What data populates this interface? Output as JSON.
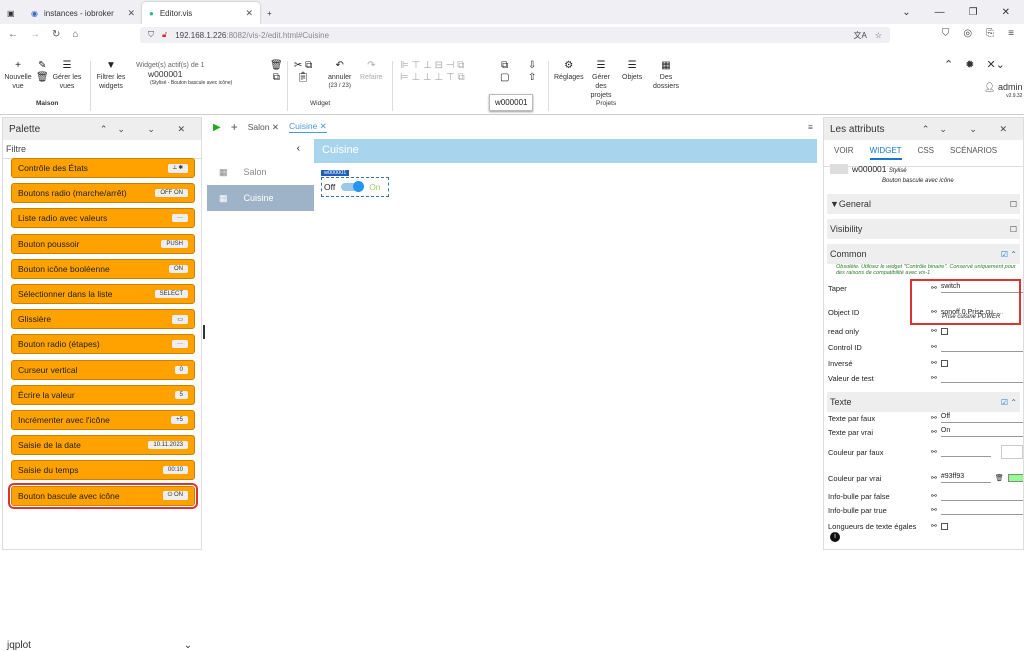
{
  "browser": {
    "tabs": [
      {
        "label": "instances - iobroker"
      },
      {
        "label": "Editor.vis"
      }
    ],
    "url_prefix": "192.168.1.226",
    "url_rest": ":8082/vis-2/edit.html#Cuisine"
  },
  "toolbar": {
    "nouvelle": "Nouvelle vue",
    "gerer_vues": "Gérer les vues",
    "maison": "Maison",
    "filtrer": "Filtrer les widgets",
    "widgets_actifs": "Widget(s) actif(s) de 1",
    "widget_id": "w000001",
    "widget_desc": "(Stylisé - Bouton bascule avec icône)",
    "annuler": "annuler",
    "annuler_count": "(23 / 23)",
    "refaire": "Refaire",
    "widget_section": "Widget",
    "reglages": "Réglages",
    "gerer_projets": "Gérer des projets",
    "objets": "Objets",
    "des_dossiers": "Des dossiers",
    "projets_section": "Projets",
    "user": "admin",
    "version": "v2.9.32",
    "tooltip": "w000001"
  },
  "palette": {
    "title": "Palette",
    "filter": "Filtre",
    "items": [
      {
        "label": "Contrôle des États",
        "prev": "⟂ ✱"
      },
      {
        "label": "Boutons radio (marche/arrêt)",
        "prev": "OFF ON"
      },
      {
        "label": "Liste radio avec valeurs",
        "prev": "···"
      },
      {
        "label": "Bouton poussoir",
        "prev": "PUSH"
      },
      {
        "label": "Bouton icône booléenne",
        "prev": "ON"
      },
      {
        "label": "Sélectionner dans la liste",
        "prev": "SELECT"
      },
      {
        "label": "Glissière",
        "prev": "▭"
      },
      {
        "label": "Bouton radio (étapes)",
        "prev": "···"
      },
      {
        "label": "Curseur vertical",
        "prev": "0"
      },
      {
        "label": "Écrire la valeur",
        "prev": "5"
      },
      {
        "label": "Incrémenter avec l'icône",
        "prev": "+5"
      },
      {
        "label": "Saisie de la date",
        "prev": "10.11.2023"
      },
      {
        "label": "Saisie du temps",
        "prev": "00:10"
      },
      {
        "label": "Bouton bascule avec icône",
        "prev": "⏻ ON"
      }
    ],
    "jqplot": "jqplot"
  },
  "editor": {
    "tabs": [
      {
        "label": "Salon"
      },
      {
        "label": "Cuisine"
      }
    ],
    "views": [
      {
        "label": "Salon"
      },
      {
        "label": "Cuisine"
      }
    ],
    "canvas_title": "Cuisine",
    "widget_label": "w000001",
    "off": "Off",
    "on": "On"
  },
  "attrs": {
    "title": "Les attributs",
    "tabs": [
      "VOIR",
      "WIDGET",
      "CSS",
      "SCÉNARIOS"
    ],
    "widget_id": "w000001",
    "stylise": "Stylisé",
    "widget_name": "Bouton bascule avec icône",
    "general": "General",
    "visibility": "Visibility",
    "common": "Common",
    "obsolete": "Obsolète. Utilisez le widget \"Contrôle binaire\". Conservé uniquement pour des raisons de compatibilité avec vis-1",
    "rows": [
      {
        "label": "Taper",
        "value": "switch"
      },
      {
        "label": "Object ID",
        "value": "sonoff.0.Prise cu",
        "sub": "Prise cuisine POWER"
      },
      {
        "label": "read only",
        "value": ""
      },
      {
        "label": "Control ID",
        "value": ""
      },
      {
        "label": "Inversé",
        "value": ""
      },
      {
        "label": "Valeur de test",
        "value": ""
      }
    ],
    "texte": "Texte",
    "trows": [
      {
        "label": "Texte par faux",
        "value": "Off"
      },
      {
        "label": "Texte par vrai",
        "value": "On"
      },
      {
        "label": "Couleur par faux",
        "value": ""
      },
      {
        "label": "Couleur par vrai",
        "value": "#93ff93"
      },
      {
        "label": "Info-bulle par false",
        "value": ""
      },
      {
        "label": "Info-bulle par true",
        "value": ""
      },
      {
        "label": "Longueurs de texte égales",
        "value": ""
      }
    ],
    "accent": "#93ff93"
  }
}
